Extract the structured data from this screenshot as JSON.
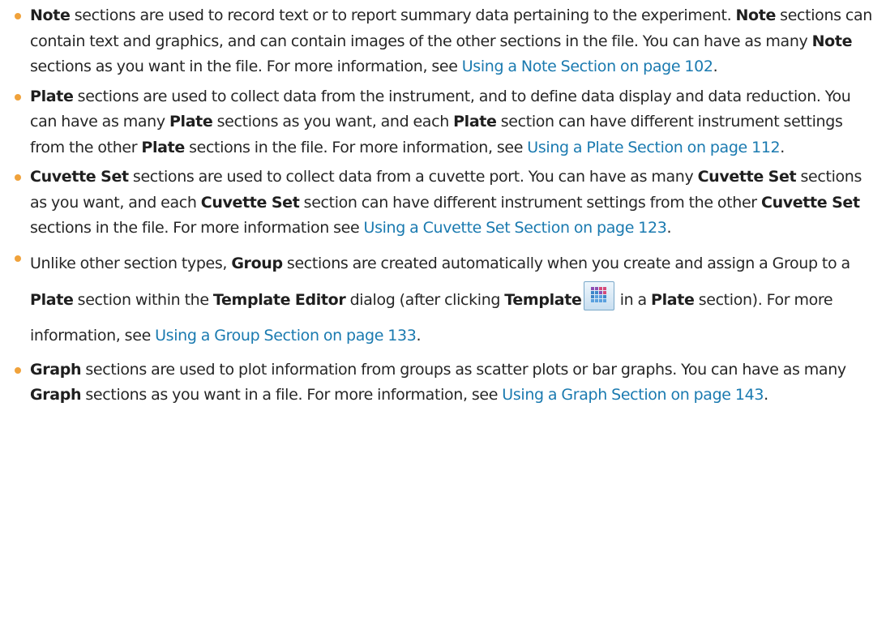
{
  "items": [
    {
      "bold1": "Note",
      "text1": " sections are used to record text or to report summary data pertaining to the experiment. ",
      "bold2": "Note",
      "text2": " sections can contain text and graphics, and can contain images of the other sections in the file. You can have as many ",
      "bold3": "Note",
      "text3": " sections as you want in the file. For more information, see ",
      "link": "Using a Note Section on page 102",
      "end": "."
    },
    {
      "bold1": "Plate",
      "text1": " sections are used to collect data from the instrument, and to define data display and data reduction. You can have as many ",
      "bold2": "Plate",
      "text2": " sections as you want, and each ",
      "bold3": "Plate",
      "text3": " section can have different instrument settings from the other ",
      "bold4": "Plate",
      "text4": " sections in the file. For more information, see ",
      "link": "Using a Plate Section on page 112",
      "end": "."
    },
    {
      "bold1": "Cuvette Set",
      "text1": " sections are used to collect data from a cuvette port. You can have as many ",
      "bold2": "Cuvette Set",
      "text2": " sections as you want, and each ",
      "bold3": "Cuvette Set",
      "text3": " section can have different instrument settings from the other ",
      "bold4": "Cuvette Set",
      "text4": " sections in the file. For more information see ",
      "link": "Using a Cuvette Set Section on page 123",
      "end": "."
    },
    {
      "text0": "Unlike other section types, ",
      "bold1": "Group",
      "text1": " sections are created automatically when you create and assign a Group to a ",
      "bold2": "Plate",
      "text2": " section within the ",
      "bold3": "Template Editor",
      "text3": " dialog (after clicking ",
      "bold4": "Template",
      "icon": "template-plate-icon",
      "text4": " in a ",
      "bold5": "Plate",
      "text5": " section). For more information, see ",
      "link": "Using a Group Section on page 133",
      "end": "."
    },
    {
      "bold1": "Graph",
      "text1": " sections are used to plot information from groups as scatter plots or bar graphs. You can have as many ",
      "bold2": "Graph",
      "text2": " sections as you want in a file. For more information, see ",
      "link": "Using a Graph Section on page 143",
      "end": "."
    }
  ],
  "colors": {
    "bullet": "#f0a23b",
    "link": "#1a7ab0",
    "text": "#262626"
  }
}
